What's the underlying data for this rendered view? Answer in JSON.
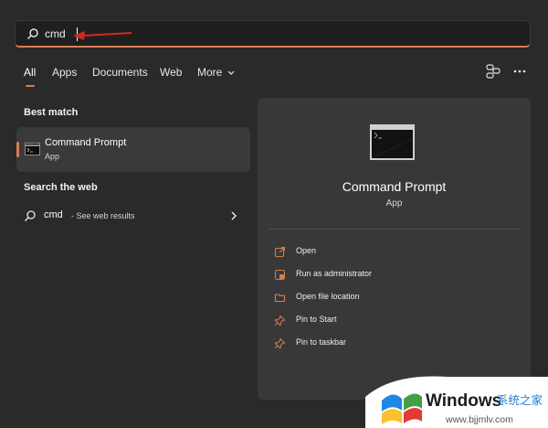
{
  "search": {
    "query": "cmd"
  },
  "tabs": [
    {
      "label": "All",
      "active": true
    },
    {
      "label": "Apps"
    },
    {
      "label": "Documents"
    },
    {
      "label": "Web"
    },
    {
      "label": "More"
    }
  ],
  "best_match": {
    "section_title": "Best match",
    "title": "Command Prompt",
    "subtitle": "App",
    "icon": "terminal-icon"
  },
  "search_web": {
    "section_title": "Search the web",
    "query": "cmd",
    "suffix": "- See web results"
  },
  "preview": {
    "title": "Command Prompt",
    "subtitle": "App",
    "actions": [
      {
        "label": "Open",
        "icon": "open-icon"
      },
      {
        "label": "Run as administrator",
        "icon": "shield-icon"
      },
      {
        "label": "Open file location",
        "icon": "folder-icon"
      },
      {
        "label": "Pin to Start",
        "icon": "pin-icon"
      },
      {
        "label": "Pin to taskbar",
        "icon": "pin-icon"
      }
    ]
  },
  "watermark": {
    "brand": "Windows",
    "site_cn": "系统之家",
    "url": "www.bjjmlv.com"
  },
  "colors": {
    "accent": "#d77d52",
    "arrow": "#d2281e",
    "background": "#2a2a2a",
    "panel": "#383838"
  }
}
